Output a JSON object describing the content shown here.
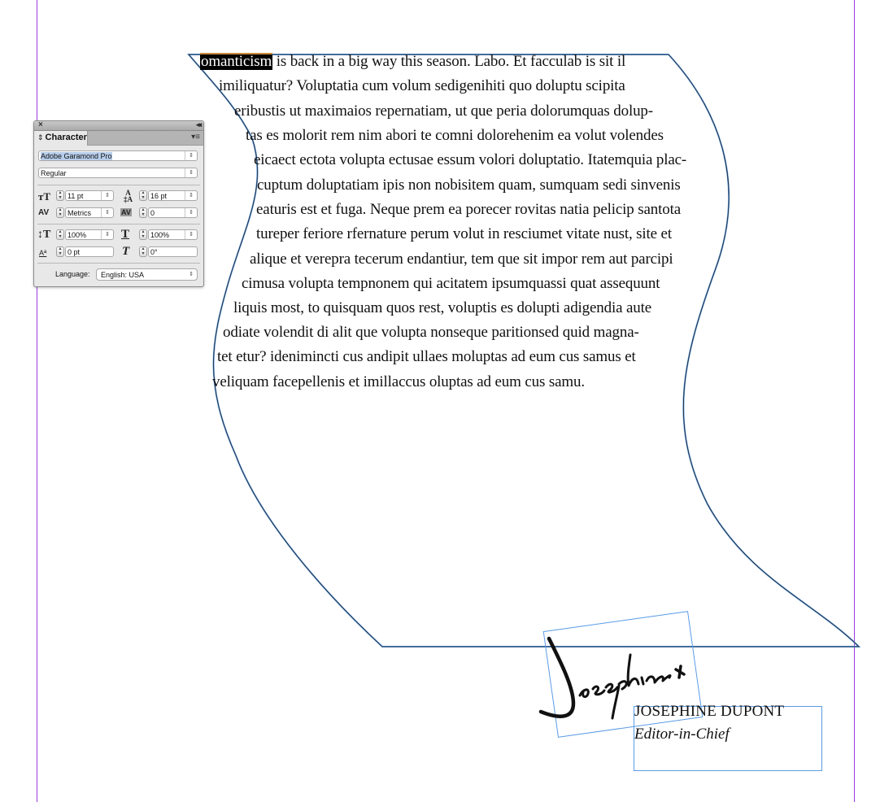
{
  "document": {
    "body_text": {
      "selected_word": "omanticism",
      "lines": [
        " is back in a big way this season. Labo. Et facculab is sit il",
        "imiliquatur? Voluptatia cum volum sedigenihiti quo doluptu scipita",
        "eribustis ut maximaios repernatiam, ut que peria dolorumquas dolup-",
        "tas es molorit rem nim abori te comni dolorehenim ea volut volendes",
        "eicaect ectota volupta ectusae essum volori doluptatio. Itatemquia plac-",
        "cuptum doluptatiam ipis non nobisitem quam, sumquam sedi sinvenis",
        "eaturis est et fuga. Neque prem ea porecer rovitas natia pelicip santota",
        "tureper feriore rfernature perum volut in resciumet vitate nust, site et",
        "alique et verepra tecerum endantiur, tem que sit impor rem aut parcipi",
        "cimusa volupta tempnonem qui acitatem ipsumquassi quat assequunt",
        "liquis most, to quisquam quos rest, voluptis es dolupti adigendia aute",
        "odiate volendit di alit que volupta nonseque paritionsed quid magna-",
        "tet etur? idenimincti cus andipit ullaes moluptas ad eum cus samus et",
        "veliquam facepellenis et imillaccus oluptas ad eum cus samu."
      ]
    },
    "signature": {
      "name": "JOSEPHINE DUPONT",
      "title": "Editor-in-Chief",
      "handwritten": "Josephine x"
    },
    "colors": {
      "margin_guide": "#9b3be0",
      "frame_edge": "#5a9be6",
      "selection_bg": "#000000"
    }
  },
  "character_panel": {
    "close_icon": "×",
    "collapse_icon": "◂◂",
    "tab_label": "Character",
    "tab_arrows": "⇕",
    "menu_icon": "▾≡",
    "font_family": "Adobe Garamond Pro",
    "font_style": "Regular",
    "font_size": "11 pt",
    "leading": "16 pt",
    "kerning": "Metrics",
    "tracking": "0",
    "vertical_scale": "100%",
    "horizontal_scale": "100%",
    "baseline_shift": "0 pt",
    "skew": "0°",
    "language_label": "Language:",
    "language": "English: USA",
    "dropdown_glyph": "⇕",
    "stepper_glyph": "▴▾"
  }
}
